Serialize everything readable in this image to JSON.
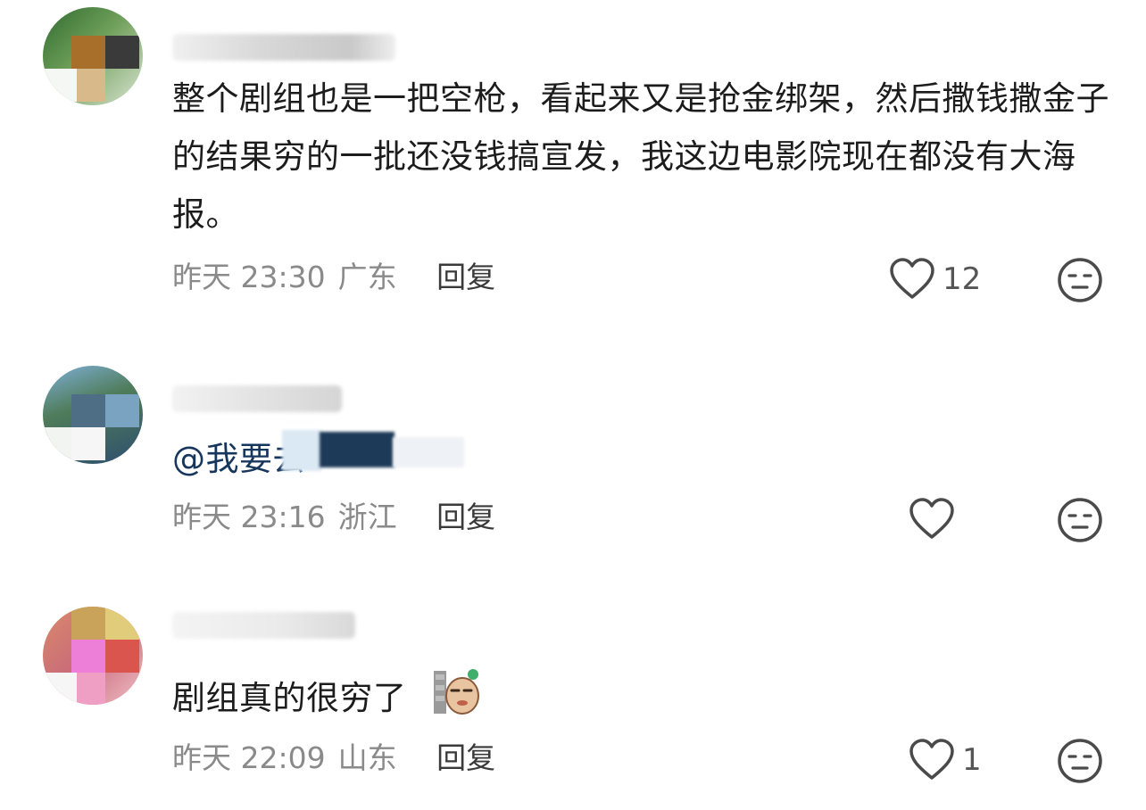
{
  "comments": [
    {
      "text": "整个剧组也是一把空枪，看起来又是抢金绑架，然后撒钱撒金子的结果穷的一批还没钱搞宣发，我这边电影院现在都没有大海报。",
      "time": "昨天 23:30",
      "location": "广东",
      "reply_label": "回复",
      "likes": "12"
    },
    {
      "mention": "@我要去",
      "time": "昨天 23:16",
      "location": "浙江",
      "reply_label": "回复",
      "likes": ""
    },
    {
      "text": "剧组真的很穷了",
      "time": "昨天 22:09",
      "location": "山东",
      "reply_label": "回复",
      "likes": "1"
    }
  ],
  "icons": {
    "like": "heart-outline-icon",
    "reaction": "neutral-face-icon"
  },
  "colors": {
    "text": "#1c1c1c",
    "meta": "#8a8a8a",
    "mention": "#16365c"
  }
}
